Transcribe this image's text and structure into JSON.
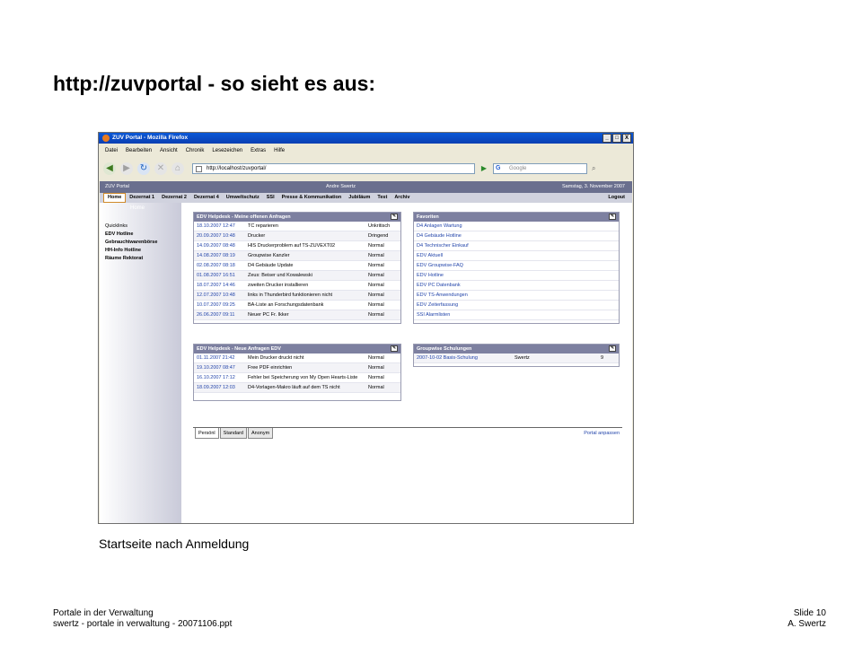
{
  "slide": {
    "title": "http://zuvportal - so sieht es aus:",
    "caption": "Startseite nach Anmeldung",
    "footer_left": [
      "Portale in der Verwaltung",
      "swertz - portale in verwaltung - 20071106.ppt"
    ],
    "footer_right": [
      "Slide 10",
      "A. Swertz"
    ]
  },
  "browser": {
    "title": "ZUV Portal - Mozilla Firefox",
    "window_buttons": [
      "_",
      "□",
      "X"
    ],
    "menu": [
      "Datei",
      "Bearbeiten",
      "Ansicht",
      "Chronik",
      "Lesezeichen",
      "Extras",
      "Hilfe"
    ],
    "url": "http://localhost/zuvportal/",
    "search_placeholder": "Google",
    "search_engine_glyph": "G"
  },
  "portal": {
    "header_left": "ZUV Portal",
    "header_user": "Andre Swertz",
    "header_date": "Samstag, 3. November 2007",
    "tabs": [
      "Home",
      "Dezernat 1",
      "Dezernat 2",
      "Dezernat 4",
      "Umweltschutz",
      "SSI",
      "Presse & Kommunikation",
      "Jubiläum",
      "Test",
      "Archiv"
    ],
    "logout": "Logout",
    "sidebar_home": "Home",
    "quicklinks_head": "Quicklinks",
    "quicklinks": [
      "EDV Hotline",
      "Gebrauchtwarenbörse",
      "HH-Info Hotline",
      "Räume Rektorat"
    ],
    "box1": {
      "title": "EDV Helpdesk - Meine offenen Anfragen",
      "rows": [
        [
          "18.10.2007 12:47",
          "TC reparieren",
          "Unkritisch"
        ],
        [
          "20.09.2007 10:48",
          "Drucker",
          "Dringend"
        ],
        [
          "14.09.2007 08:48",
          "HIS Druckerproblem auf TS-ZUVEXT02",
          "Normal"
        ],
        [
          "14.08.2007 08:19",
          "Groupwise Kanzler",
          "Normal"
        ],
        [
          "02.08.2007 08:18",
          "D4 Gebäude Update",
          "Normal"
        ],
        [
          "01.08.2007 16:51",
          "Zeus: Beiser und Kowalewski",
          "Normal"
        ],
        [
          "18.07.2007 14:46",
          "zweiten Drucker installieren",
          "Normal"
        ],
        [
          "12.07.2007 10:48",
          "links in Thunderbird funktionieren nicht",
          "Normal"
        ],
        [
          "10.07.2007 09:25",
          "BA-Liste an Forschungsdatenbank",
          "Normal"
        ],
        [
          "26.06.2007 09:11",
          "Neuer PC Fr. Ikker",
          "Normal"
        ]
      ]
    },
    "box2": {
      "title": "Favoriten",
      "links": [
        "D4 Anlagen Wartung",
        "D4 Gebäude Hotline",
        "D4 Technischer Einkauf",
        "EDV Aktuell",
        "EDV Groupwise-FAQ",
        "EDV Hotline",
        "EDV PC Datenbank",
        "EDV TS-Anwendungen",
        "EDV Zeiterfassung",
        "SSI Alarmlisten"
      ]
    },
    "box3": {
      "title": "EDV Helpdesk - Neue Anfragen EDV",
      "rows": [
        [
          "01.11.2007 21:42",
          "Mein Drucker druckt nicht",
          "Normal"
        ],
        [
          "19.10.2007 08:47",
          "Free PDF einrichten",
          "Normal"
        ],
        [
          "16.10.2007 17:12",
          "Fehler bei Speicherung von My Open Hearts-Liste",
          "Normal"
        ],
        [
          "18.09.2007 12:03",
          "D4-Vorlagen-Makro läuft auf dem TS nicht",
          "Normal"
        ]
      ]
    },
    "box4": {
      "title": "Groupwise Schulungen",
      "row": [
        "2007-10-02 Basis-Schulung",
        "Swertz",
        "9"
      ]
    },
    "bottom_tabs": [
      "Persönl",
      "Standard",
      "Anonym"
    ],
    "portal_anpassen": "Portal anpassen"
  }
}
